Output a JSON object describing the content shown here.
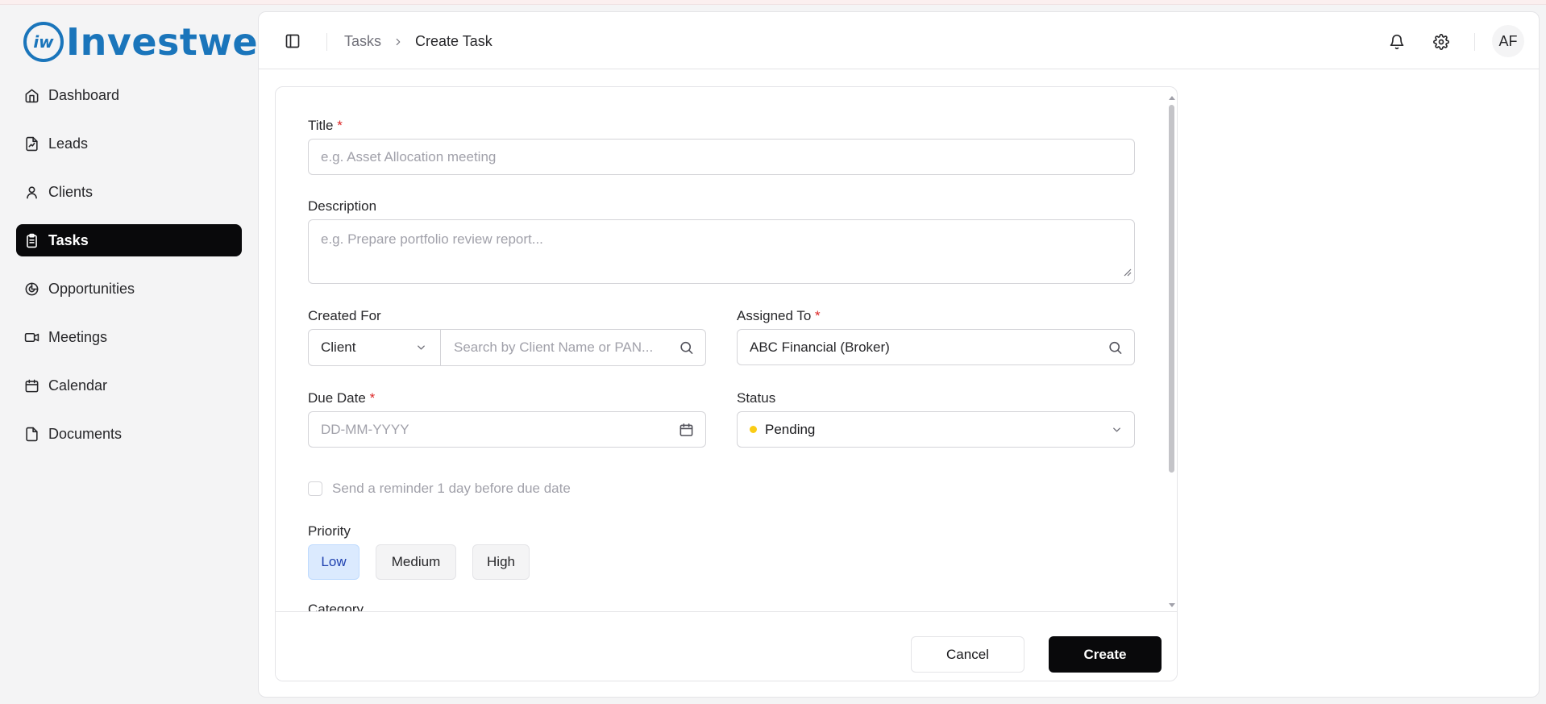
{
  "app": {
    "brand": "Investwell",
    "brand_color": "#1a75bb"
  },
  "sidebar": {
    "items": [
      {
        "label": "Dashboard",
        "icon": "home-icon"
      },
      {
        "label": "Leads",
        "icon": "file-chart-icon"
      },
      {
        "label": "Clients",
        "icon": "user-icon"
      },
      {
        "label": "Tasks",
        "icon": "clipboard-icon",
        "active": true
      },
      {
        "label": "Opportunities",
        "icon": "pie-chart-icon"
      },
      {
        "label": "Meetings",
        "icon": "video-icon"
      },
      {
        "label": "Calendar",
        "icon": "calendar-icon"
      },
      {
        "label": "Documents",
        "icon": "document-icon"
      }
    ]
  },
  "header": {
    "breadcrumb": [
      "Tasks",
      "Create Task"
    ],
    "avatar_initials": "AF"
  },
  "form": {
    "title": {
      "label": "Title",
      "required_mark": "*",
      "placeholder": "e.g. Asset Allocation meeting"
    },
    "description": {
      "label": "Description",
      "placeholder": "e.g. Prepare portfolio review report..."
    },
    "created_for": {
      "label": "Created For",
      "type_value": "Client",
      "search_placeholder": "Search by Client Name or PAN..."
    },
    "assigned_to": {
      "label": "Assigned To",
      "required_mark": "*",
      "value": "ABC Financial (Broker)"
    },
    "due_date": {
      "label": "Due Date",
      "required_mark": "*",
      "placeholder": "DD-MM-YYYY"
    },
    "status": {
      "label": "Status",
      "value": "Pending",
      "dot_color": "#facc15"
    },
    "reminder": {
      "label": "Send a reminder 1 day before due date",
      "checked": false
    },
    "priority": {
      "label": "Priority",
      "options": [
        "Low",
        "Medium",
        "High"
      ],
      "selected": "Low"
    },
    "category": {
      "label": "Category"
    }
  },
  "footer": {
    "cancel_label": "Cancel",
    "create_label": "Create"
  }
}
